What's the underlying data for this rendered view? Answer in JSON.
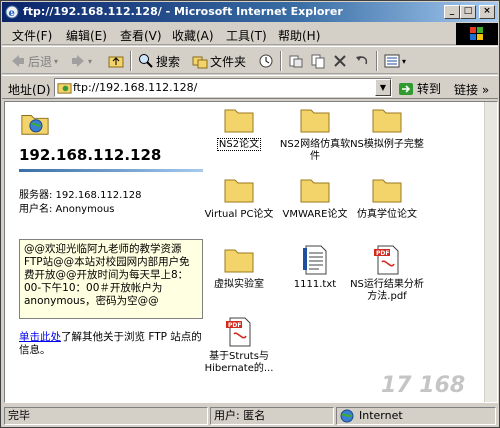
{
  "window": {
    "title": "ftp://192.168.112.128/ - Microsoft Internet Explorer"
  },
  "titlebar_buttons": {
    "minimize": "_",
    "maximize": "□",
    "close": "×"
  },
  "menu": [
    "文件(F)",
    "编辑(E)",
    "查看(V)",
    "收藏(A)",
    "工具(T)",
    "帮助(H)"
  ],
  "toolbar": {
    "back": "后退",
    "search": "搜索",
    "folders": "文件夹"
  },
  "address": {
    "label": "地址(D)",
    "value": "ftp://192.168.112.128/",
    "go_label": "转到",
    "links_label": "链接"
  },
  "sidebar": {
    "host": "192.168.112.128",
    "server_line": "服务器: 192.168.112.128",
    "user_line": "用户名: Anonymous",
    "message": "@@欢迎光临阿九老师的教学资源FTP站@@本站对校园网内部用户免费开放@@开放时间为每天早上8：00-下午10：00＃开放帐户为anonymous，密码为空@@",
    "help_link": "单击此处",
    "help_rest": "了解其他关于浏览 FTP 站点的信息。"
  },
  "files": [
    {
      "name": "NS2论文",
      "type": "folder"
    },
    {
      "name": "NS2网络仿真软件",
      "type": "folder"
    },
    {
      "name": "NS模拟例子完整",
      "type": "folder"
    },
    {
      "name": "Virtual PC论文",
      "type": "folder"
    },
    {
      "name": "VMWARE论文",
      "type": "folder"
    },
    {
      "name": "仿真学位论文",
      "type": "folder"
    },
    {
      "name": "虚拟实验室",
      "type": "folder"
    },
    {
      "name": "1111.txt",
      "type": "txt"
    },
    {
      "name": "NS运行结果分析方法.pdf",
      "type": "pdf"
    },
    {
      "name": "基于Struts与Hibernate的...",
      "type": "pdf"
    }
  ],
  "status": {
    "left": "完毕",
    "user": "用户: 匿名",
    "zone": "Internet"
  },
  "watermark": "17 168",
  "colors": {
    "folder": "#f2d46a",
    "title_bar": "#0a246a",
    "link": "#0000ee"
  }
}
